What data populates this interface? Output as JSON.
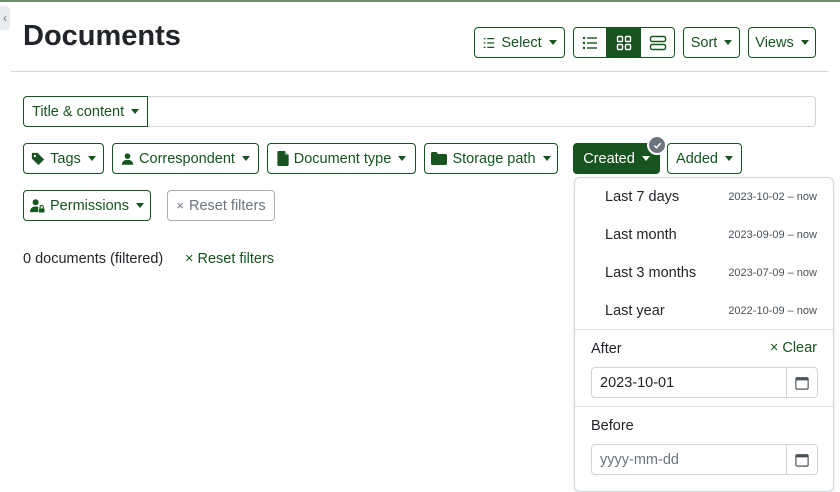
{
  "header": {
    "title": "Documents",
    "select_label": "Select",
    "sort_label": "Sort",
    "views_label": "Views"
  },
  "search": {
    "mode_label": "Title & content",
    "value": ""
  },
  "filters": {
    "tags": "Tags",
    "correspondent": "Correspondent",
    "document_type": "Document type",
    "storage_path": "Storage path",
    "created": "Created",
    "added": "Added",
    "permissions": "Permissions",
    "reset": "Reset filters"
  },
  "status": {
    "count_text": "0 documents (filtered)",
    "reset_link": "Reset filters"
  },
  "created_dropdown": {
    "quick_ranges": [
      {
        "label": "Last 7 days",
        "range": "2023-10-02 – now"
      },
      {
        "label": "Last month",
        "range": "2023-09-09 – now"
      },
      {
        "label": "Last 3 months",
        "range": "2023-07-09 – now"
      },
      {
        "label": "Last year",
        "range": "2022-10-09 – now"
      }
    ],
    "after_label": "After",
    "clear_label": "Clear",
    "after_value": "2023-10-01",
    "before_label": "Before",
    "before_placeholder": "yyyy-mm-dd"
  },
  "colors": {
    "primary": "#17541f",
    "badge": "#6c757d"
  }
}
